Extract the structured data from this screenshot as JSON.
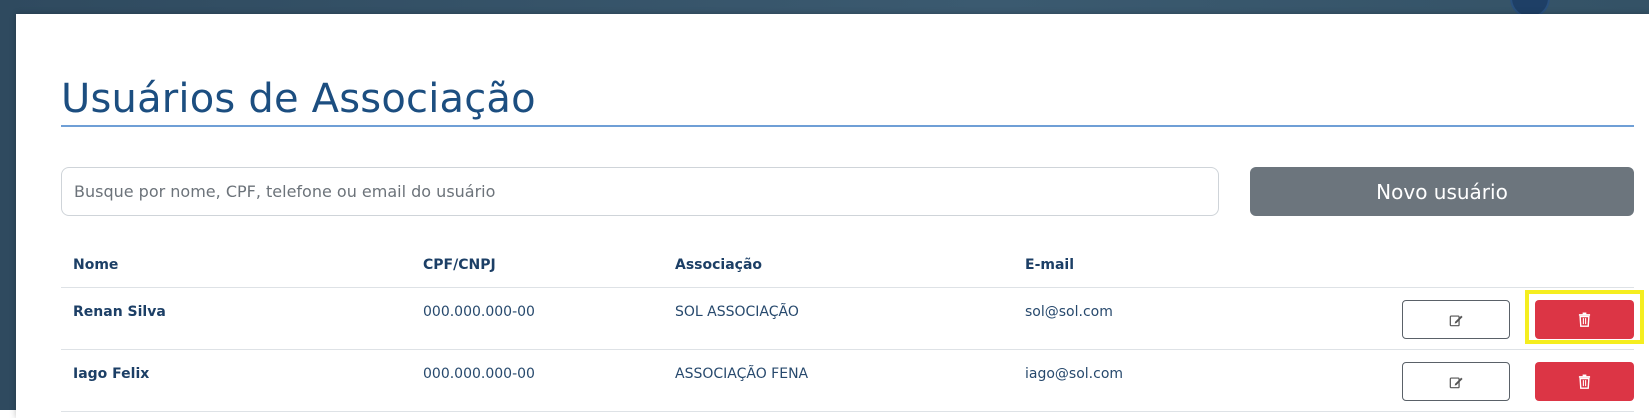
{
  "page": {
    "title": "Usuários de Associação"
  },
  "search": {
    "placeholder": "Busque por nome, CPF, telefone ou email do usuário",
    "value": ""
  },
  "toolbar": {
    "new_user_label": "Novo usuário"
  },
  "table": {
    "headers": [
      "Nome",
      "CPF/CNPJ",
      "Associação",
      "E-mail",
      ""
    ],
    "rows": [
      {
        "name": "Renan Silva",
        "document": "000.000.000-00",
        "association": "SOL ASSOCIAÇÃO",
        "email": "sol@sol.com",
        "edit_icon": "edit-icon",
        "delete_icon": "trash-icon",
        "delete_highlighted": true
      },
      {
        "name": "Iago Felix",
        "document": "000.000.000-00",
        "association": "ASSOCIAÇÃO FENA",
        "email": "iago@sol.com",
        "edit_icon": "edit-icon",
        "delete_icon": "trash-icon",
        "delete_highlighted": false
      }
    ]
  },
  "colors": {
    "title": "#1c4e80",
    "title_rule": "#6f9fd6",
    "primary_button": "#6c757d",
    "danger": "#dc3545",
    "highlight": "#f5ee1f",
    "header_background": "#2f4a5f"
  }
}
